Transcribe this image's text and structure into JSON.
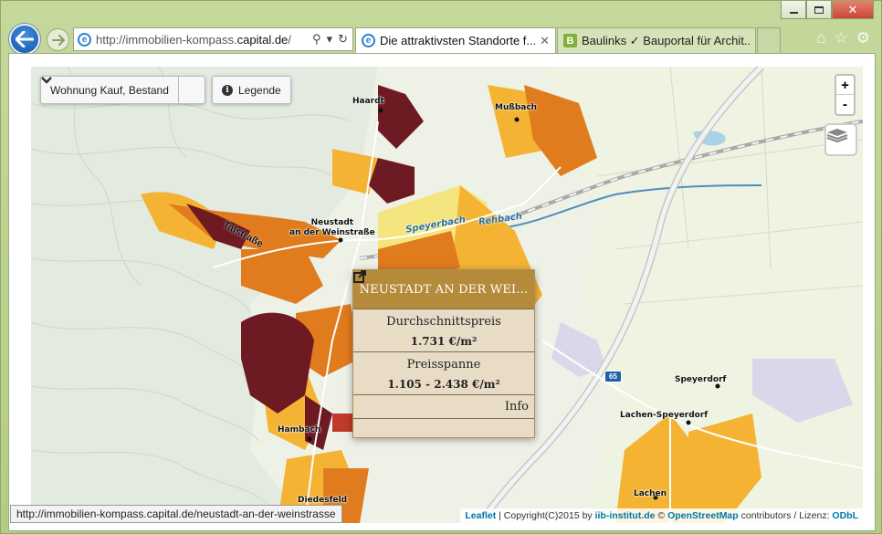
{
  "browser": {
    "address_bar": {
      "url_prefix": "http://immobilien-kompass.",
      "url_host": "capital.de",
      "url_suffix": "/"
    },
    "tabs": [
      {
        "label": "Die attraktivsten Standorte f...",
        "active": true
      },
      {
        "label": "Baulinks ✓ Bauportal für Archit...",
        "active": false
      }
    ],
    "status_url": "http://immobilien-kompass.capital.de/neustadt-an-der-weinstrasse"
  },
  "map": {
    "layer_select": {
      "label": "Wohnung Kauf, Bestand"
    },
    "legend_button": {
      "label": "Legende"
    },
    "zoom": {
      "in": "+",
      "out": "-"
    },
    "place_labels": {
      "haardt": "Haardt",
      "mussbach": "Mußbach",
      "neustadt_line1": "Neustadt",
      "neustadt_line2": "an der Weinstraße",
      "hambach": "Hambach",
      "diedesfeld": "Diedesfeld",
      "speyerdorf": "Speyerdorf",
      "lachen_speyerdorf": "Lachen-Speyerdorf",
      "lachen": "Lachen"
    },
    "water_labels": {
      "speyerbach": "Speyerbach",
      "rehbach": "Rehbach"
    },
    "road_labels": {
      "talstrasse": "Talstraße",
      "highway": "65"
    },
    "popup": {
      "title": "NEUSTADT AN DER WEI...",
      "avg_label": "Durchschnittspreis",
      "avg_value": "1.731 €/m²",
      "range_label": "Preisspanne",
      "range_value": "1.105 - 2.438 €/m²",
      "info_label": "Info"
    },
    "attribution": {
      "leaflet": "Leaflet",
      "copyright": " | Copyright(C)2015 by ",
      "iib": "iib-institut.de",
      "copy_sign": " © ",
      "osm": "OpenStreetMap",
      "license": " contributors / Lizenz: ",
      "odbl": "ODbL"
    },
    "colors": {
      "price_very_high": "#6e1a22",
      "price_high": "#e07b1e",
      "price_mid": "#f4b332",
      "price_low": "#f5e57e",
      "forest": "#e4ebe0",
      "water": "#a8d3e6"
    }
  }
}
